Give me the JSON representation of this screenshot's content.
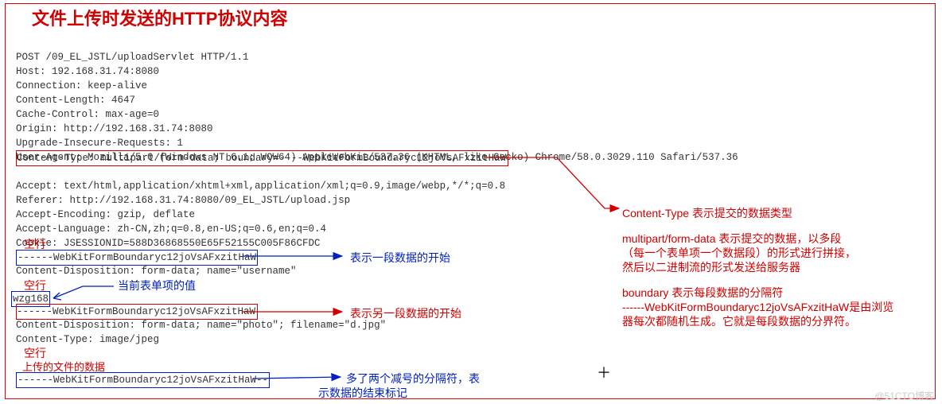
{
  "title": "文件上传时发送的HTTP协议内容",
  "http": {
    "l1": "POST /09_EL_JSTL/uploadServlet HTTP/1.1",
    "l2": "Host: 192.168.31.74:8080",
    "l3": "Connection: keep-alive",
    "l4": "Content-Length: 4647",
    "l5": "Cache-Control: max-age=0",
    "l6": "Origin: http://192.168.31.74:8080",
    "l7": "Upgrade-Insecure-Requests: 1",
    "l8": "User-Agent: Mozilla/5.0 (Windows NT 6.1; WOW64) AppleWebKit/537.36 (KHTML, like Gecko) Chrome/58.0.3029.110 Safari/537.36",
    "ct": "Content-Type: multipart/form-data; boundary=----WebKitFormBoundaryc12joVsAFxzitHaW",
    "l10": "Accept: text/html,application/xhtml+xml,application/xml;q=0.9,image/webp,*/*;q=0.8",
    "l11": "Referer: http://192.168.31.74:8080/09_EL_JSTL/upload.jsp",
    "l12": "Accept-Encoding: gzip, deflate",
    "l13": "Accept-Language: zh-CN,zh;q=0.8,en-US;q=0.6,en;q=0.4",
    "l14": "Cookie: JSESSIONID=588D36868550E65F52155C005F86CFDC",
    "b1": "------WebKitFormBoundaryc12joVsAFxzitHaW",
    "cd1": "Content-Disposition: form-data; name=\"username\"",
    "val": "wzg168",
    "b2": "------WebKitFormBoundaryc12joVsAFxzitHaW",
    "cd2": "Content-Disposition: form-data; name=\"photo\"; filename=\"d.jpg\"",
    "ct2": "Content-Type: image/jpeg",
    "b3": "------WebKitFormBoundaryc12joVsAFxzitHaW--"
  },
  "labels": {
    "blank1": "空行",
    "blank2": "空行",
    "blank3": "空行",
    "curval": "当前表单项的值",
    "filedata": "上传的文件的数据"
  },
  "ann": {
    "startSeg": "表示一段数据的开始",
    "startSeg2": "表示另一段数据的开始",
    "endSeg1": "多了两个减号的分隔符，表",
    "endSeg2": "示数据的结束标记",
    "ctline": "Content-Type 表示提交的数据类型",
    "mp1": "multipart/form-data 表示提交的数据，以多段",
    "mp2": "（每一个表单项一个数据段）的形式进行拼接，",
    "mp3": "然后以二进制流的形式发送给服务器",
    "bd1": "boundary 表示每段数据的分隔符",
    "bd2": "------WebKitFormBoundaryc12joVsAFxzitHaW是由浏览",
    "bd3": "器每次都随机生成。它就是每段数据的分界符。"
  },
  "watermark": "@51CTO博客"
}
